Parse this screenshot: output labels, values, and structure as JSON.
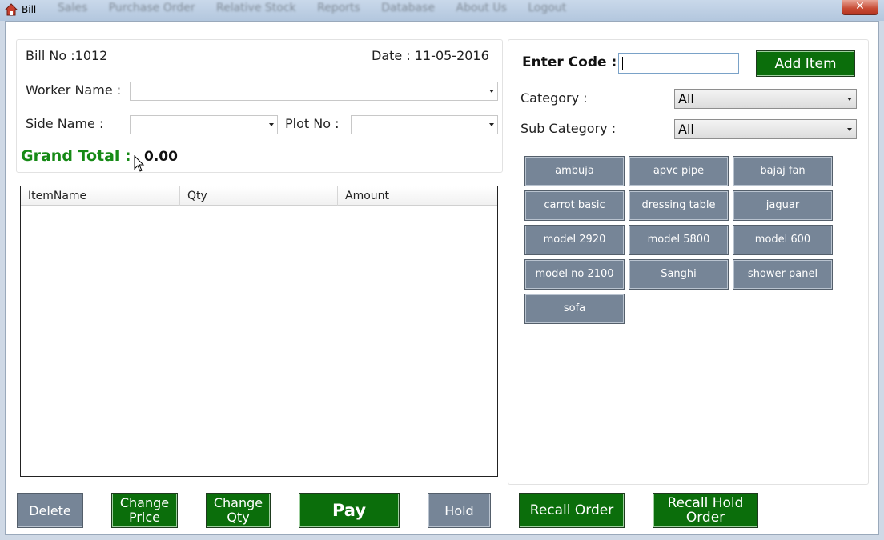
{
  "window": {
    "title": "Bill",
    "close_glyph": "✕",
    "menu_blurred": [
      "Sales",
      "Purchase Order",
      "Relative Stock",
      "Reports",
      "Database",
      "About Us",
      "Logout"
    ]
  },
  "bill": {
    "bill_no_label": "Bill No :1012",
    "date_label": "Date : 11-05-2016",
    "worker_name_label": "Worker Name :",
    "side_name_label": "Side Name :",
    "plot_no_label": "Plot No :",
    "grand_total_label": "Grand Total :",
    "grand_total_value": "0.00"
  },
  "grid": {
    "columns": [
      "ItemName",
      "Qty",
      "Amount"
    ],
    "rows": []
  },
  "right": {
    "enter_code_label": "Enter Code :",
    "add_item_label": "Add Item",
    "category_label": "Category :",
    "category_value": "All",
    "sub_category_label": "Sub Category :",
    "sub_category_value": "All"
  },
  "items": [
    "ambuja",
    "apvc pipe",
    "bajaj fan",
    "carrot basic",
    "dressing table",
    "jaguar",
    "model 2920",
    "model 5800",
    "model 600",
    "model no 2100",
    "Sanghi",
    "shower panel",
    "sofa"
  ],
  "footer": {
    "delete": "Delete",
    "change_price_1": "Change",
    "change_price_2": "Price",
    "change_qty_1": "Change",
    "change_qty_2": "Qty",
    "pay": "Pay",
    "hold": "Hold",
    "recall_order": "Recall Order",
    "recall_hold_1": "Recall Hold",
    "recall_hold_2": "Order"
  },
  "colors": {
    "green_button": "#0b6e0b",
    "grey_button": "#768597",
    "grand_total_text": "#168a16"
  }
}
